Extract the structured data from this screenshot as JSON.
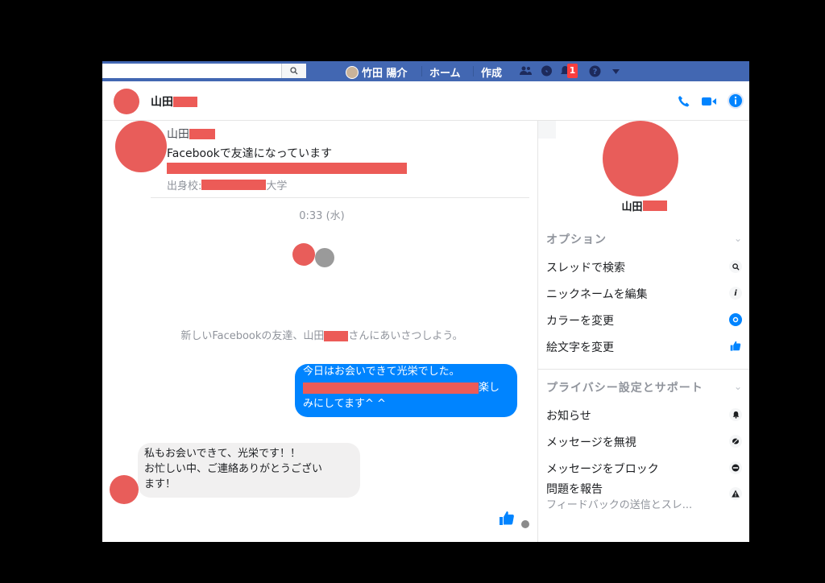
{
  "topbar": {
    "user_name": "竹田 陽介",
    "home_label": "ホーム",
    "create_label": "作成",
    "notification_count": "1"
  },
  "header": {
    "name": "山田"
  },
  "profile": {
    "name": "山田",
    "friend_status": "Facebookで友達になっています",
    "school_prefix": "出身校: ",
    "school_suffix": "大学"
  },
  "chat": {
    "timestamp": "0:33 (水)",
    "intro_prefix": "新しいFacebookの友達、山田",
    "intro_suffix": "さんにあいさつしよう。",
    "outgoing": {
      "line1": "今日はお会いできて光栄でした。",
      "line2_suffix": "楽し",
      "line3": "みにしてます^ ^"
    },
    "incoming": {
      "line1": "私もお会いできて、光栄です！！",
      "line2": "お忙しい中、ご連絡ありがとうござい",
      "line3": "ます！"
    }
  },
  "info": {
    "name": "山田",
    "options_title": "オプション",
    "options": [
      {
        "label": "スレッドで検索",
        "icon": "search-icon"
      },
      {
        "label": "ニックネームを編集",
        "icon": "edit-icon"
      },
      {
        "label": "カラーを変更",
        "icon": "color-icon"
      },
      {
        "label": "絵文字を変更",
        "icon": "thumbs-up-icon"
      }
    ],
    "privacy_title": "プライバシー設定とサポート",
    "privacy": [
      {
        "label": "お知らせ",
        "icon": "bell-icon"
      },
      {
        "label": "メッセージを無視",
        "icon": "ignore-icon"
      },
      {
        "label": "メッセージをブロック",
        "icon": "block-icon"
      },
      {
        "label": "問題を報告",
        "icon": "warning-icon"
      }
    ],
    "report_sub": "フィードバックの送信とスレ..."
  },
  "colors": {
    "accent": "#0084ff",
    "nav": "#4267b2",
    "redaction": "#ec5b57",
    "avatar": "#e85d5a"
  }
}
